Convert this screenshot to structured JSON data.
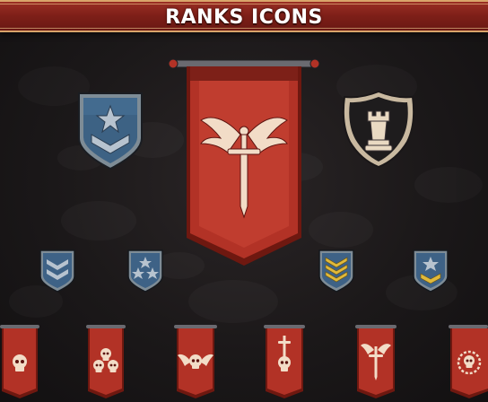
{
  "header": {
    "title": "RANKS ICONS"
  },
  "icons": [
    {
      "name": "private-chevron-star-badge-icon",
      "shape": "shield",
      "color": "#3e6286"
    },
    {
      "name": "banner-winged-sword-icon",
      "shape": "banner",
      "color": "#b23226"
    },
    {
      "name": "rook-chess-shield-icon",
      "shape": "crest",
      "color": "#1e1c1d"
    },
    {
      "name": "double-chevron-badge-icon",
      "shape": "shield",
      "color": "#3e6286"
    },
    {
      "name": "three-star-badge-icon",
      "shape": "shield",
      "color": "#3e6286"
    },
    {
      "name": "gold-triple-chevron-badge-icon",
      "shape": "shield",
      "color": "#3e6286"
    },
    {
      "name": "star-gold-chevron-badge-icon",
      "shape": "shield",
      "color": "#3e6286"
    },
    {
      "name": "banner-skull-icon",
      "shape": "banner",
      "color": "#b23226"
    },
    {
      "name": "banner-three-skulls-icon",
      "shape": "banner",
      "color": "#b23226"
    },
    {
      "name": "banner-winged-skull-icon",
      "shape": "banner",
      "color": "#b23226"
    },
    {
      "name": "banner-sword-skull-icon",
      "shape": "banner",
      "color": "#b23226"
    },
    {
      "name": "banner-winged-sword-small-icon",
      "shape": "banner",
      "color": "#b23226"
    },
    {
      "name": "banner-laurel-skull-icon",
      "shape": "banner",
      "color": "#b23226"
    }
  ]
}
